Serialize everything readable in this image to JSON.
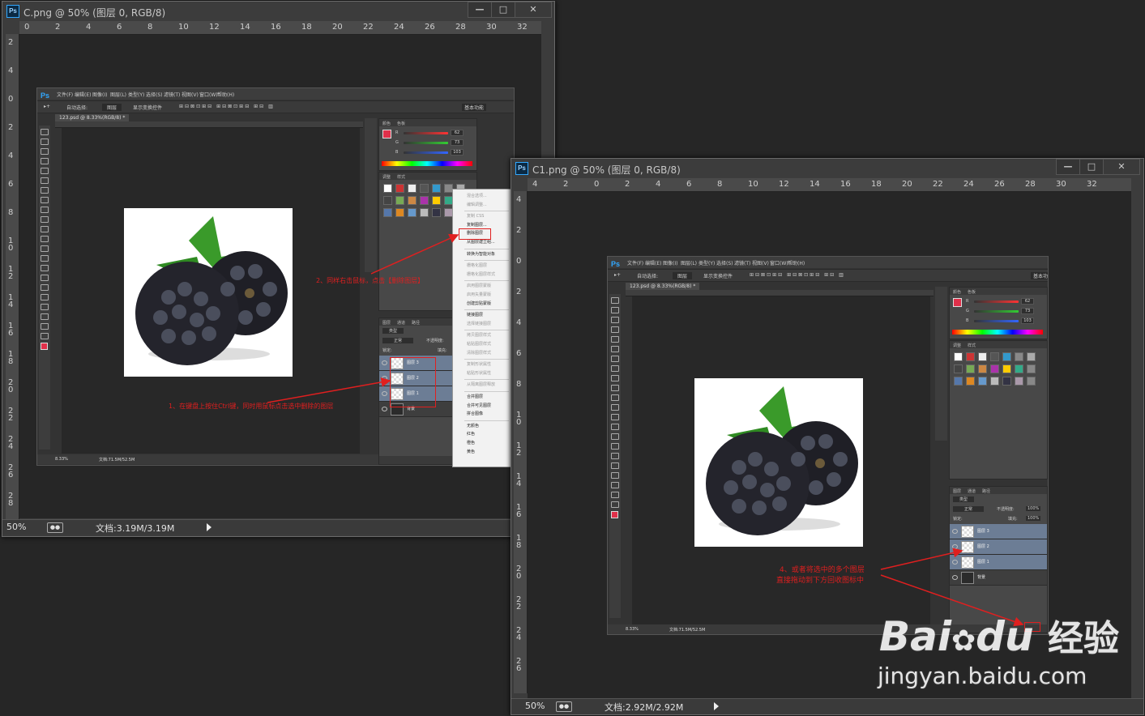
{
  "window1": {
    "title": "C.png @ 50% (图层 0, RGB/8)",
    "zoom": "50%",
    "doc_size": "文档:3.19M/3.19M",
    "ps_badge": "Ps",
    "ruler_h": [
      "0",
      "2",
      "4",
      "6",
      "8",
      "10",
      "12",
      "14",
      "16",
      "18",
      "20",
      "22",
      "24",
      "26",
      "28",
      "30",
      "32"
    ],
    "ruler_v": [
      "2",
      "4",
      "0",
      "2",
      "4",
      "6",
      "8",
      "1 0",
      "1 2",
      "1 4",
      "1 6",
      "1 8",
      "2 0",
      "2 2",
      "2 4",
      "2 6",
      "2 8",
      "3 0"
    ]
  },
  "window2": {
    "title": "C1.png @ 50% (图层 0, RGB/8)",
    "zoom": "50%",
    "doc_size": "文档:2.92M/2.92M",
    "ps_badge": "Ps",
    "ruler_h": [
      "4",
      "2",
      "0",
      "2",
      "4",
      "6",
      "8",
      "10",
      "12",
      "14",
      "16",
      "18",
      "20",
      "22",
      "24",
      "26",
      "28",
      "30",
      "32"
    ],
    "ruler_v": [
      "4",
      "2",
      "0",
      "2",
      "4",
      "6",
      "8",
      "1 0",
      "1 2",
      "1 4",
      "1 6",
      "1 8",
      "2 0",
      "2 2",
      "2 4",
      "2 6"
    ]
  },
  "window_buttons": {
    "minimize": "—",
    "maximize": "□",
    "close": "✕"
  },
  "inner": {
    "ps": "Ps",
    "menus": [
      "文件(F)",
      "编辑(E)",
      "图像(I)",
      "图层(L)",
      "类型(Y)",
      "选择(S)",
      "滤镜(T)",
      "视图(V)",
      "窗口(W)",
      "帮助(H)"
    ],
    "options": {
      "auto_select": "自动选择:",
      "layer": "图层",
      "show_transform": "显示变换控件",
      "workspace": "基本功能"
    },
    "doc_tab": "123.psd @ 8.33%(RGB/8) *",
    "status_zoom": "8.33%",
    "status_doc": "文档:71.5M/52.5M",
    "color_tabs": [
      "颜色",
      "色板"
    ],
    "style_tabs": [
      "调整",
      "样式"
    ],
    "layer_tabs": [
      "图层",
      "通道",
      "路径"
    ],
    "rgb": {
      "r_label": "R",
      "g_label": "G",
      "b_label": "B",
      "r": "62",
      "g": "73",
      "b": "103"
    },
    "kind_label": "类型",
    "blend_mode": "正常",
    "opacity_label": "不透明度:",
    "opacity": "100%",
    "lock_label": "锁定:",
    "fill_label": "填充:",
    "fill": "100%",
    "layers": [
      "图层 3",
      "图层 2",
      "图层 1",
      "背景"
    ]
  },
  "context_menu": {
    "items": [
      "混合选项...",
      "编辑调整...",
      "复制 CSS",
      "复制图层...",
      "删除图层",
      "从图层建立组...",
      "转换为智能对象",
      "栅格化图层",
      "栅格化图层样式",
      "启用图层蒙版",
      "启用矢量蒙版",
      "创建剪贴蒙版",
      "链接图层",
      "选择链接图层",
      "拷贝图层样式",
      "粘贴图层样式",
      "清除图层样式",
      "复制形状属性",
      "粘贴形状属性",
      "从隔离图层释放",
      "合并图层",
      "合并可见图层",
      "拼合图像",
      "无颜色",
      "红色",
      "橙色",
      "黄色"
    ],
    "disabled": [
      true,
      true,
      true,
      false,
      false,
      false,
      false,
      true,
      true,
      true,
      true,
      false,
      false,
      true,
      true,
      true,
      true,
      true,
      true,
      true,
      false,
      false,
      false,
      false,
      false,
      false,
      false
    ]
  },
  "annotations": {
    "step1": "1、在键盘上按住Ctrl键，同时用鼠标点击选中删除的图层",
    "step2": "2、同样右击鼠标，点击【删除图层】",
    "step4_line1": "4、或者将选中的多个图层",
    "step4_line2": "直接拖动到下方回收图标中"
  },
  "watermark": {
    "brand_a": "Bai",
    "brand_b": "du",
    "brand_cn": "经验",
    "url": "jingyan.baidu.com"
  },
  "colors": {
    "accent_red": "#e01f1f",
    "ps_blue": "#31a8ff",
    "selected_layer": "#6c7d95"
  }
}
